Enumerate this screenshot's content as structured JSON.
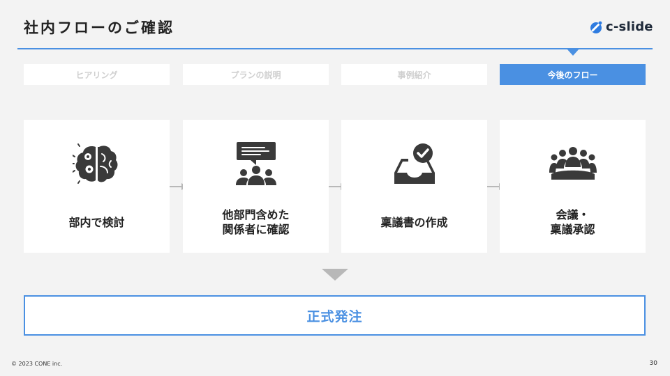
{
  "header": {
    "title": "社内フローのご確認",
    "logo_text": "c-slide"
  },
  "tabs": [
    {
      "label": "ヒアリング",
      "active": false
    },
    {
      "label": "プランの説明",
      "active": false
    },
    {
      "label": "事例紹介",
      "active": false
    },
    {
      "label": "今後のフロー",
      "active": true
    }
  ],
  "steps": [
    {
      "label": "部内で検討",
      "icon": "brain-gears-icon"
    },
    {
      "label": "他部門含めた\n関係者に確認",
      "icon": "presentation-group-icon"
    },
    {
      "label": "稟議書の作成",
      "icon": "inbox-check-icon"
    },
    {
      "label": "会議・\n稟議承認",
      "icon": "meeting-table-icon"
    }
  ],
  "result": {
    "label": "正式発注"
  },
  "footer": {
    "copyright": "© 2023 CONE inc.",
    "page_number": "30"
  },
  "colors": {
    "accent": "#4a90e2",
    "background": "#f3f3f3",
    "icon": "#3a3a3a",
    "arrow": "#b8b8b8"
  }
}
